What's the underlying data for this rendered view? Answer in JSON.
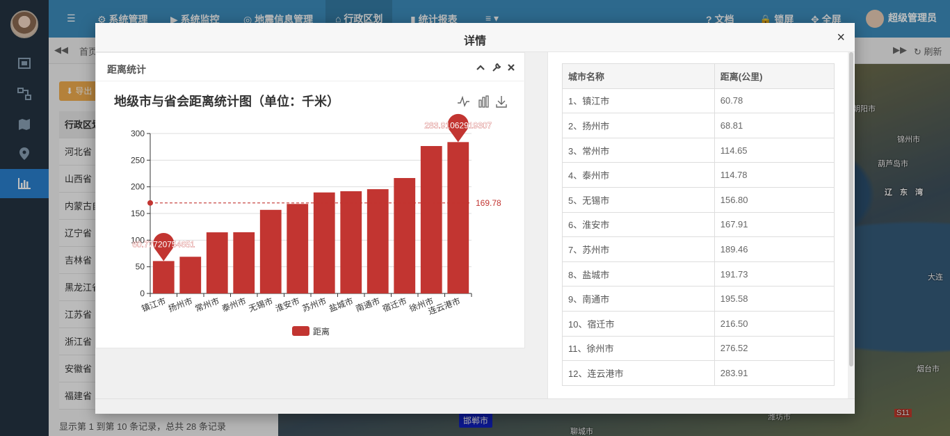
{
  "topbar": {
    "menu_items": [
      "系统管理",
      "系统监控",
      "地震信息管理",
      "行政区划",
      "统计报表",
      "≡"
    ],
    "right_items": [
      "文档",
      "锁屏",
      "全屏",
      "超级管理员"
    ]
  },
  "tabstrip": {
    "home": "首页",
    "refresh": "刷新"
  },
  "leftpanel": {
    "export_label": "导出",
    "header": "行政区划",
    "provinces": [
      "河北省",
      "山西省",
      "内蒙古自治区",
      "辽宁省",
      "吉林省",
      "黑龙江省",
      "江苏省",
      "浙江省",
      "安徽省",
      "福建省"
    ],
    "pager_text": "显示第 1 到第 10 条记录，总共 28 条记录"
  },
  "map": {
    "labels": [
      "朝阳市",
      "锦州市",
      "葫芦岛市",
      "辽 东 湾",
      "大连",
      "烟台市",
      "邯郸市",
      "聊城市",
      "潍坊市",
      "S11"
    ],
    "highlight_city": "邯郸市"
  },
  "modal": {
    "title": "详情",
    "close_icon": "×"
  },
  "chart_panel": {
    "title": "距离统计"
  },
  "chart_data": {
    "type": "bar",
    "title": "地级市与省会距离统计图（单位：千米）",
    "categories": [
      "镇江市",
      "扬州市",
      "常州市",
      "泰州市",
      "无锡市",
      "淮安市",
      "苏州市",
      "盐城市",
      "南通市",
      "宿迁市",
      "徐州市",
      "连云港市"
    ],
    "series": [
      {
        "name": "距离",
        "color": "#c23531",
        "values": [
          60.78,
          68.81,
          114.65,
          114.78,
          156.8,
          167.91,
          189.46,
          191.73,
          195.58,
          216.5,
          276.52,
          283.91
        ]
      }
    ],
    "ylim": [
      0,
      300
    ],
    "yticks": [
      0,
      50,
      100,
      150,
      200,
      250,
      300
    ],
    "mark_max_label": "283.91062919307",
    "mark_min_label": "60.77720754651",
    "mark_line_value": 169.78,
    "mark_line_label": "169.78",
    "legend_position": "bottom-center",
    "grid": true
  },
  "table": {
    "headers": [
      "城市名称",
      "距离(公里)"
    ],
    "rows": [
      [
        "1、镇江市",
        "60.78"
      ],
      [
        "2、扬州市",
        "68.81"
      ],
      [
        "3、常州市",
        "114.65"
      ],
      [
        "4、泰州市",
        "114.78"
      ],
      [
        "5、无锡市",
        "156.80"
      ],
      [
        "6、淮安市",
        "167.91"
      ],
      [
        "7、苏州市",
        "189.46"
      ],
      [
        "8、盐城市",
        "191.73"
      ],
      [
        "9、南通市",
        "195.58"
      ],
      [
        "10、宿迁市",
        "216.50"
      ],
      [
        "11、徐州市",
        "276.52"
      ],
      [
        "12、连云港市",
        "283.91"
      ]
    ]
  }
}
